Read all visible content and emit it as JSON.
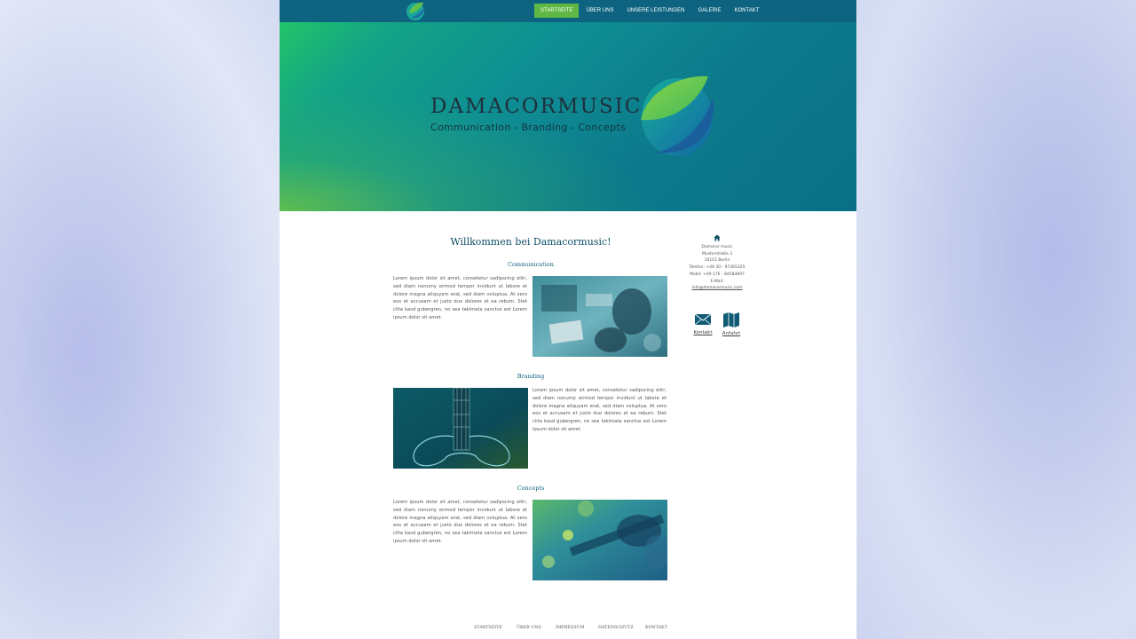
{
  "nav": {
    "items": [
      {
        "label": "STARTSEITE",
        "active": true
      },
      {
        "label": "ÜBER UNS",
        "active": false
      },
      {
        "label": "UNSERE LEISTUNGEN",
        "active": false
      },
      {
        "label": "GALERIE",
        "active": false
      },
      {
        "label": "KONTAKT",
        "active": false
      }
    ]
  },
  "hero": {
    "title": "DAMACORMUSIC",
    "subtitle": "Communication - Branding - Concepts"
  },
  "main": {
    "welcome": "Willkommen bei Damacormusic!",
    "sections": [
      {
        "title": "Communication",
        "text": "Lorem ipsum dolor sit amet, consetetur sadipscing elitr, sed diam nonumy eirmod tempor invidunt ut labore et dolore magna aliquyam erat, sed diam voluptua. At vero eos et accusam et justo duo dolores et ea rebum. Stet clita kasd gubergren, no sea takimata sanctus est Lorem ipsum dolor sit amet."
      },
      {
        "title": "Branding",
        "text": "Lorem ipsum dolor sit amet, consetetur sadipscing elitr, sed diam nonumy eirmod tempor invidunt ut labore et dolore magna aliquyam erat, sed diam voluptua. At vero eos et accusam et justo duo dolores et ea rebum. Stet clita kasd gubergren, no sea takimata sanctus est Lorem ipsum dolor sit amet."
      },
      {
        "title": "Concepts",
        "text": "Lorem ipsum dolor sit amet, consetetur sadipscing elitr, sed diam nonumy eirmod tempor invidunt ut labore et dolore magna aliquyam erat, sed diam voluptua. At vero eos et accusam et justo duo dolores et ea rebum. Stet clita kasd gubergren, no sea takimata sanctus est Lorem ipsum dolor sit amet."
      }
    ]
  },
  "sidebar": {
    "icon": "home-icon",
    "lines": [
      "Damacor music",
      "Musterstraße 3",
      "10115 Berlin",
      "Telefon: +49 30 - 97365325",
      "Mobil: +49 176 - 84584697",
      "E-Mail:"
    ],
    "email": "info@damacormusic.com",
    "kontakt_label": "Kontakt",
    "anfahrt_label": "Anfahrt"
  },
  "footer": {
    "items": [
      "STARTSEITE",
      "ÜBER UNS",
      "IMPRESSUM",
      "DATENSCHUTZ",
      "KONTAKT"
    ]
  },
  "colors": {
    "nav_bg": "#0e6480",
    "nav_active": "#5fb844",
    "accent": "#0f5f7a"
  }
}
